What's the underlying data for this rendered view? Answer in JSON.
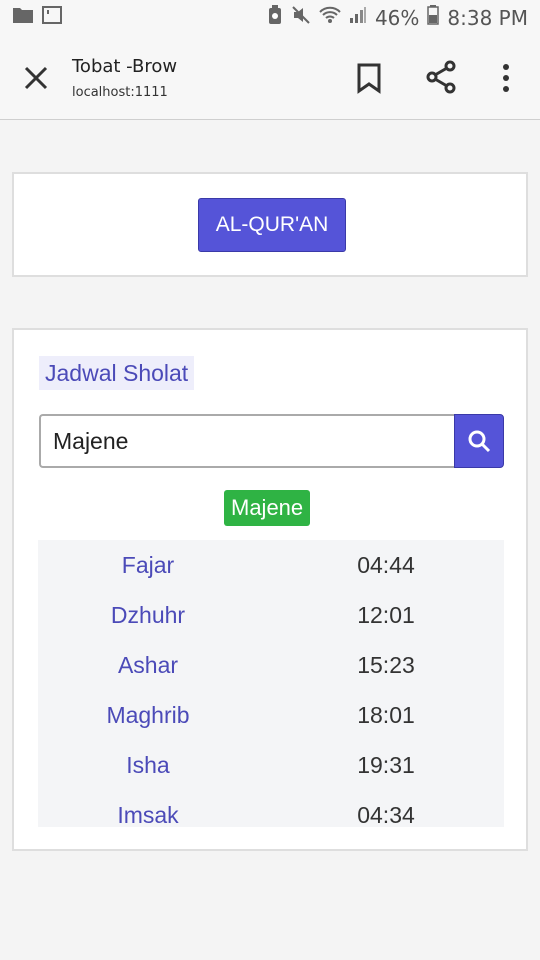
{
  "status_bar": {
    "battery": "46%",
    "time": "8:38 PM"
  },
  "toolbar": {
    "title": "Tobat -Brow",
    "url": "localhost:1111"
  },
  "quran_button": {
    "label": "AL-QUR'AN"
  },
  "sholat": {
    "heading": "Jadwal Sholat",
    "search_value": "Majene",
    "city": "Majene",
    "times": [
      {
        "name": "Fajar",
        "time": "04:44"
      },
      {
        "name": "Dzhuhr",
        "time": "12:01"
      },
      {
        "name": "Ashar",
        "time": "15:23"
      },
      {
        "name": "Maghrib",
        "time": "18:01"
      },
      {
        "name": "Isha",
        "time": "19:31"
      },
      {
        "name": "Imsak",
        "time": "04:34"
      }
    ]
  },
  "colors": {
    "primary": "#5554d8",
    "city_badge": "#2fb344",
    "link_text": "#4b4ab8"
  }
}
